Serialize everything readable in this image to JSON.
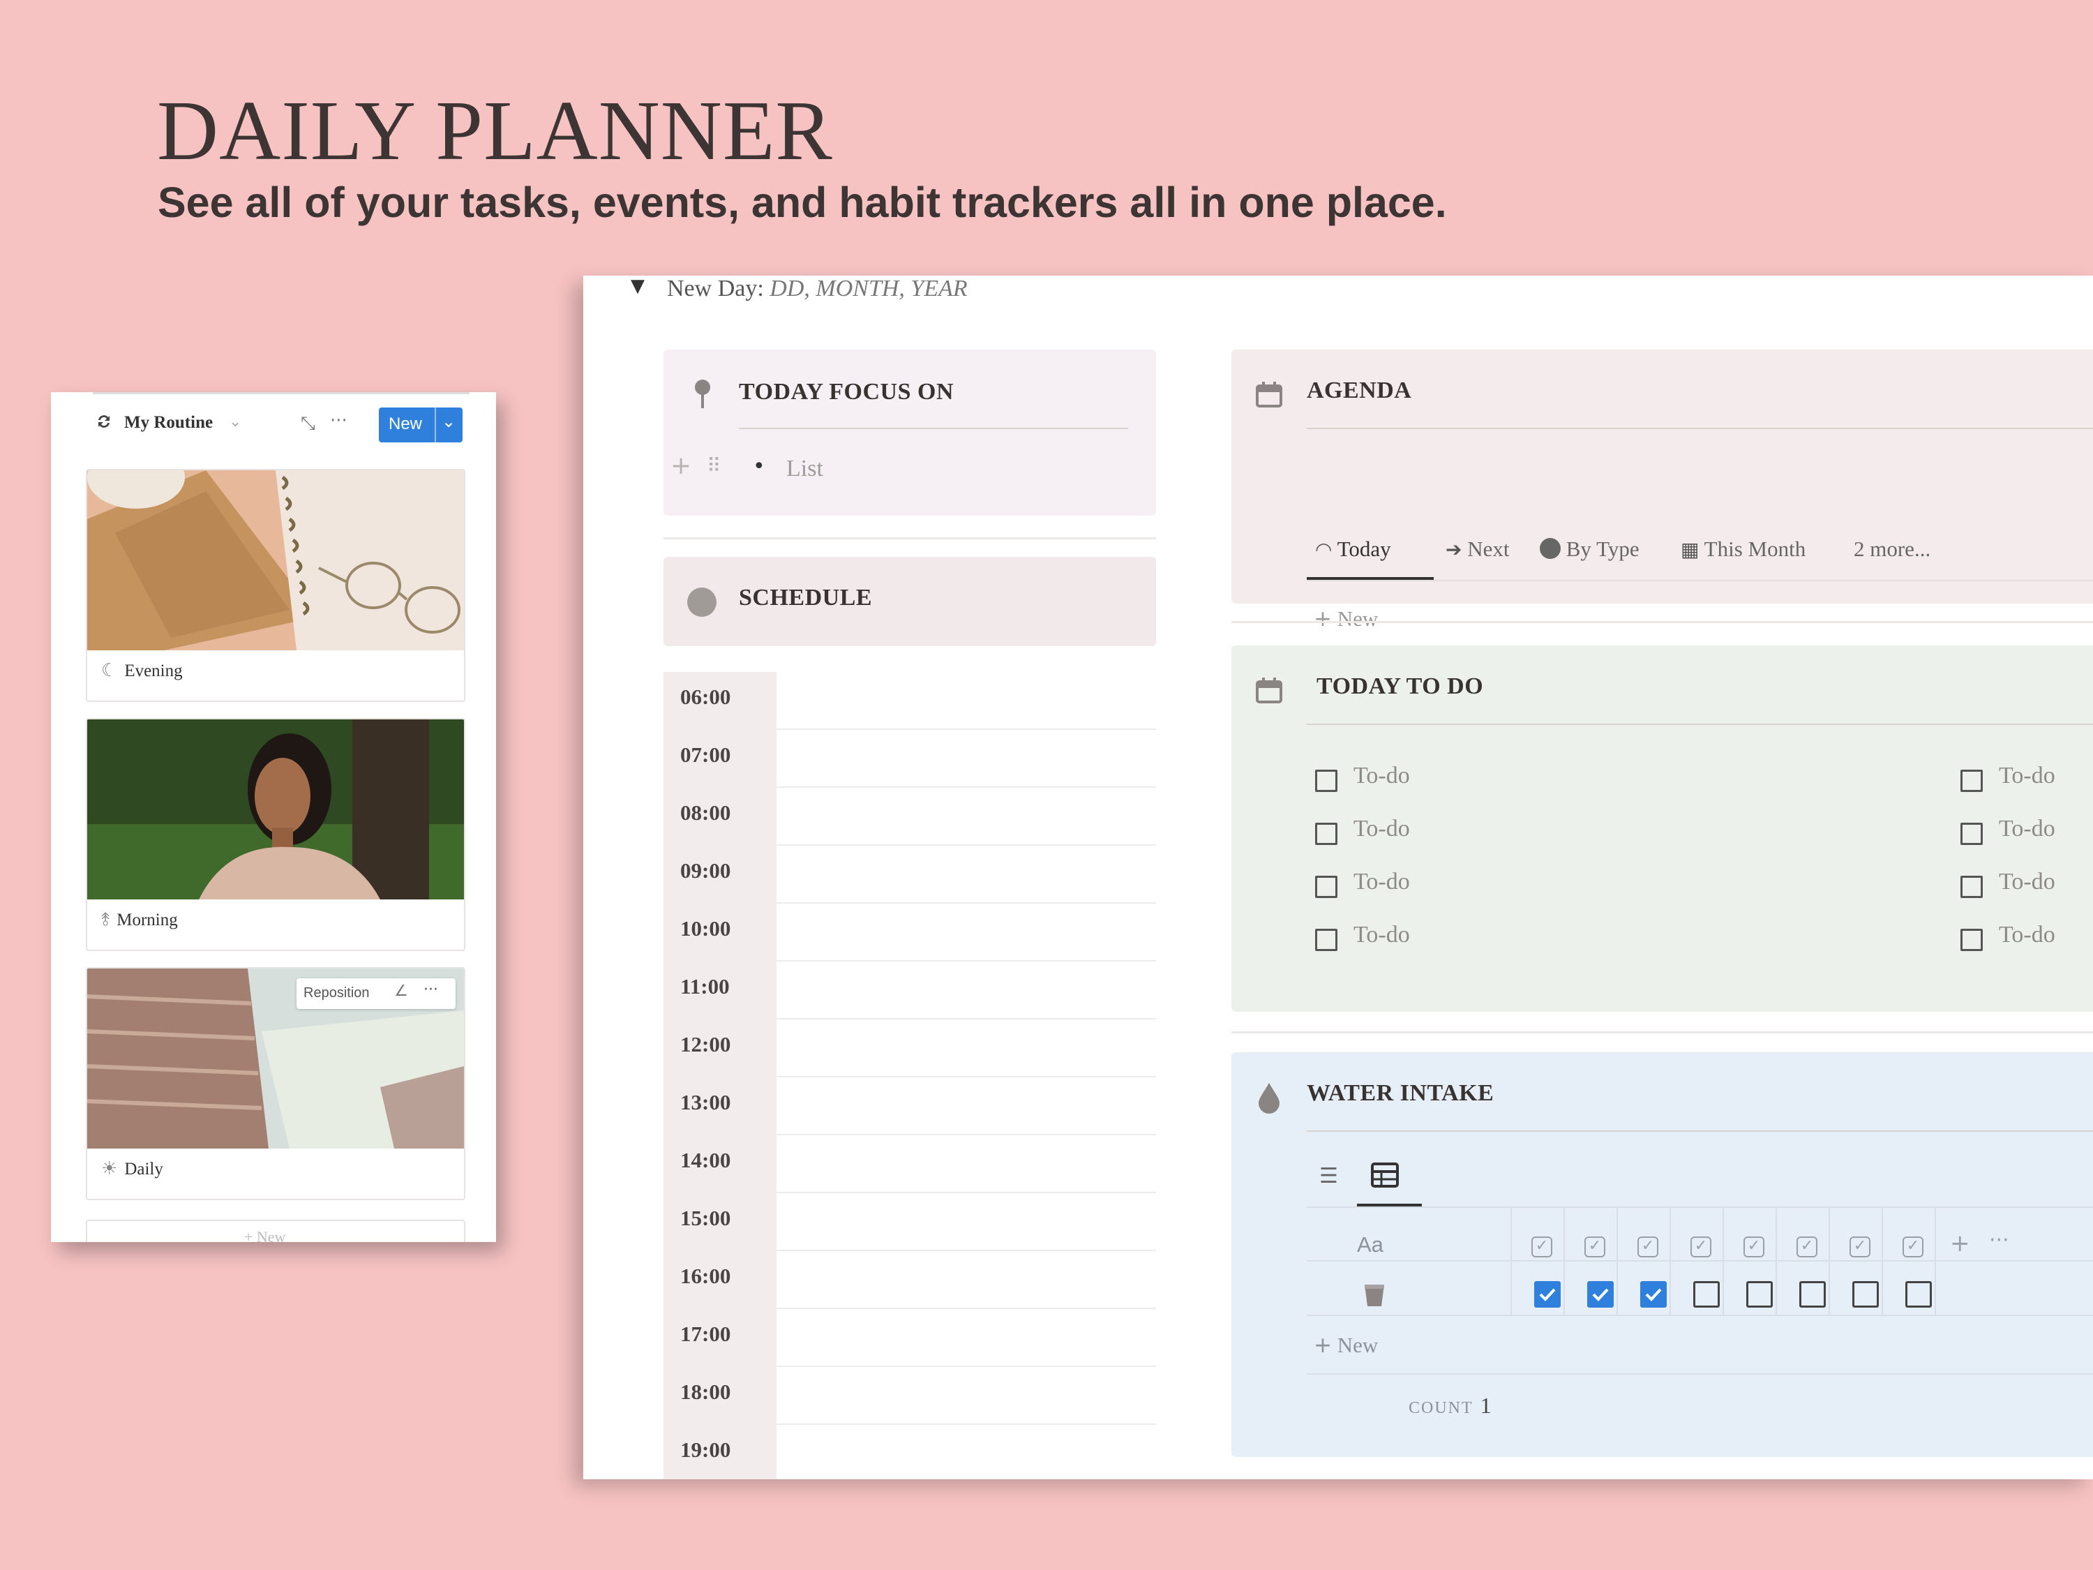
{
  "header": {
    "title": "DAILY PLANNER",
    "subtitle": "See all of your tasks, events, and habit trackers all in one place."
  },
  "routine": {
    "title": "My Routine",
    "new_label": "New",
    "cards": [
      {
        "label": "Evening",
        "icon": "moon-icon"
      },
      {
        "label": "Morning",
        "icon": "sunrise-icon"
      },
      {
        "label": "Daily",
        "icon": "sun-icon"
      }
    ],
    "reposition_label": "Reposition",
    "footer_new": "+ New"
  },
  "page": {
    "new_day_label": "New Day:",
    "new_day_value": "DD, MONTH, YEAR"
  },
  "focus": {
    "title": "TODAY FOCUS ON",
    "list_placeholder": "List"
  },
  "schedule": {
    "title": "SCHEDULE",
    "times": [
      "06:00",
      "07:00",
      "08:00",
      "09:00",
      "10:00",
      "11:00",
      "12:00",
      "13:00",
      "14:00",
      "15:00",
      "16:00",
      "17:00",
      "18:00",
      "19:00"
    ]
  },
  "agenda": {
    "title": "AGENDA",
    "tabs": [
      {
        "label": "Today",
        "icon": "rainbow-icon"
      },
      {
        "label": "Next",
        "icon": "arrow-circle-icon"
      },
      {
        "label": "By Type",
        "icon": "circle-icon"
      },
      {
        "label": "This Month",
        "icon": "calendar-icon"
      },
      {
        "label": "2 more...",
        "icon": ""
      }
    ],
    "new_label": "New"
  },
  "todo": {
    "title": "TODAY TO DO",
    "left": [
      "To-do",
      "To-do",
      "To-do",
      "To-do"
    ],
    "right": [
      "To-do",
      "To-do",
      "To-do",
      "To-do"
    ]
  },
  "water": {
    "title": "WATER INTAKE",
    "name_header": "Aa",
    "checks": [
      true,
      true,
      true,
      false,
      false,
      false,
      false,
      false
    ],
    "new_label": "New",
    "count_label": "COUNT",
    "count_value": "1"
  },
  "colors": {
    "background": "#f6c3c2",
    "accent": "#2f80dd",
    "focus_bg": "#f6f0f5",
    "agenda_bg": "#f4ecec",
    "todo_bg": "#ecf2eb",
    "water_bg": "#e6eff7"
  }
}
